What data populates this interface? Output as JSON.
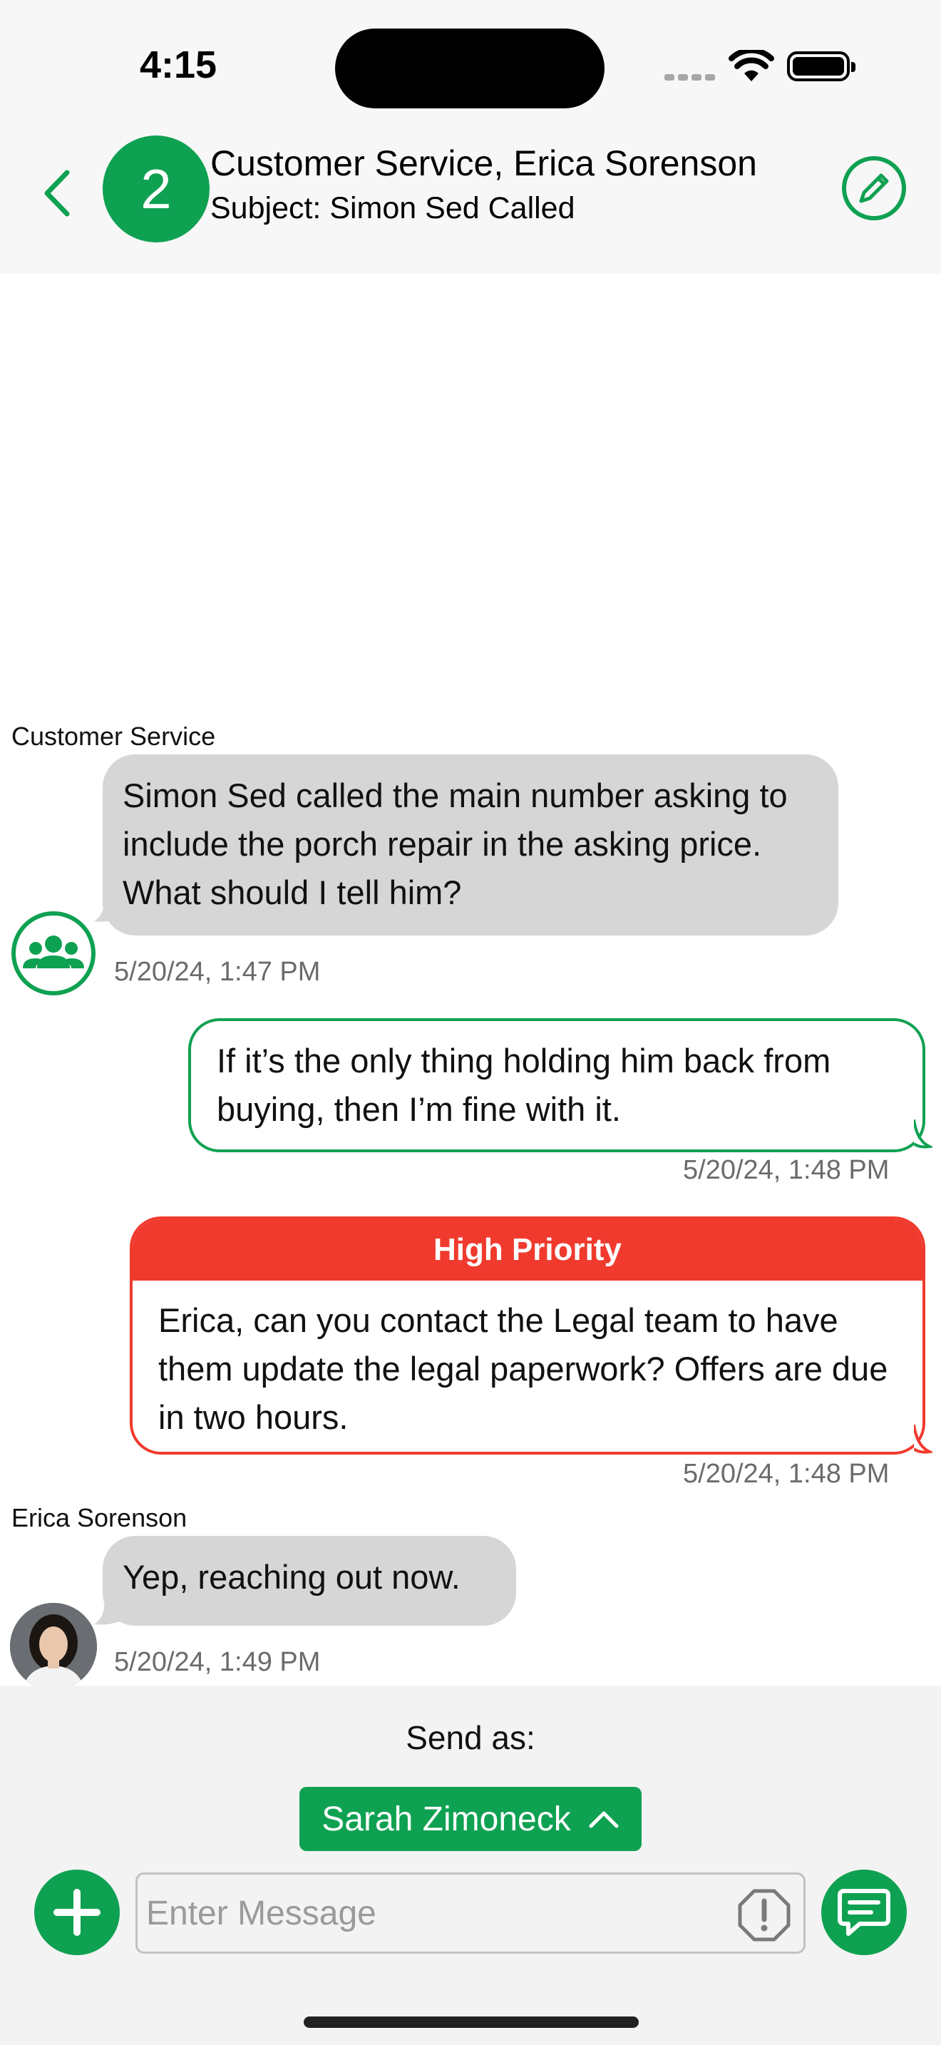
{
  "status_bar": {
    "time": "4:15"
  },
  "header": {
    "participant_count": "2",
    "title": "Customer Service, Erica Sorenson",
    "subject": "Subject: Simon Sed Called"
  },
  "messages": [
    {
      "sender": "Customer Service",
      "text": "Simon Sed called the main number asking to include the porch repair in the asking price. What should I tell him?",
      "time": "5/20/24, 1:47 PM",
      "avatar_icon": "group-icon"
    },
    {
      "text": "If it’s the only thing holding him back from buying, then I’m fine with it.",
      "time": "5/20/24, 1:48 PM"
    },
    {
      "priority_label": "High Priority",
      "text": "Erica, can you contact the Legal team to have them update the legal paperwork? Offers are due in two hours.",
      "time": "5/20/24, 1:48 PM"
    },
    {
      "sender": "Erica Sorenson",
      "text": "Yep, reaching out now.",
      "time": "5/20/24, 1:49 PM"
    }
  ],
  "composer": {
    "send_as_label": "Send as:",
    "send_as_value": "Sarah Zimoneck",
    "placeholder": "Enter Message"
  },
  "colors": {
    "accent": "#0fa152",
    "priority": "#f03a2e",
    "incoming_bubble": "#d6d6d6"
  }
}
